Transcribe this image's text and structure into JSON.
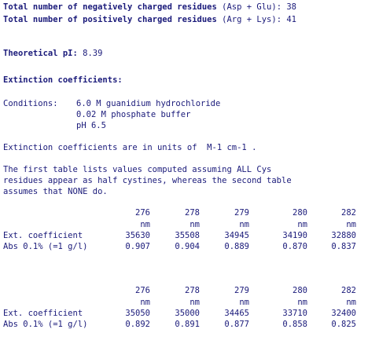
{
  "charged": {
    "neg_label": "Total number of negatively charged residues",
    "neg_paren": "(Asp + Glu):",
    "neg_value": "38",
    "pos_label": "Total number of positively charged residues",
    "pos_paren": "(Arg + Lys):",
    "pos_value": "41"
  },
  "pi": {
    "label": "Theoretical pI:",
    "value": "8.39"
  },
  "extinction": {
    "heading": "Extinction coefficients:",
    "conditions_label": "Conditions:",
    "conditions": [
      "6.0 M guanidium hydrochloride",
      "0.02 M phosphate buffer",
      "pH 6.5"
    ],
    "units_line": "Extinction coefficients are in units of  M-1 cm-1 .",
    "explanation": [
      "The first table lists values computed assuming ALL Cys",
      "residues appear as half cystines, whereas the second table",
      "assumes that NONE do."
    ]
  },
  "tables": {
    "wavelengths": [
      "276",
      "278",
      "279",
      "280",
      "282"
    ],
    "unit": "nm",
    "row1_label": "Ext. coefficient",
    "row2_label": "Abs 0.1% (=1 g/l)",
    "table1": {
      "ext": [
        "35630",
        "35508",
        "34945",
        "34190",
        "32880"
      ],
      "abs": [
        "0.907",
        "0.904",
        "0.889",
        "0.870",
        "0.837"
      ]
    },
    "table2": {
      "ext": [
        "35050",
        "35000",
        "34465",
        "33710",
        "32400"
      ],
      "abs": [
        "0.892",
        "0.891",
        "0.877",
        "0.858",
        "0.825"
      ]
    }
  }
}
